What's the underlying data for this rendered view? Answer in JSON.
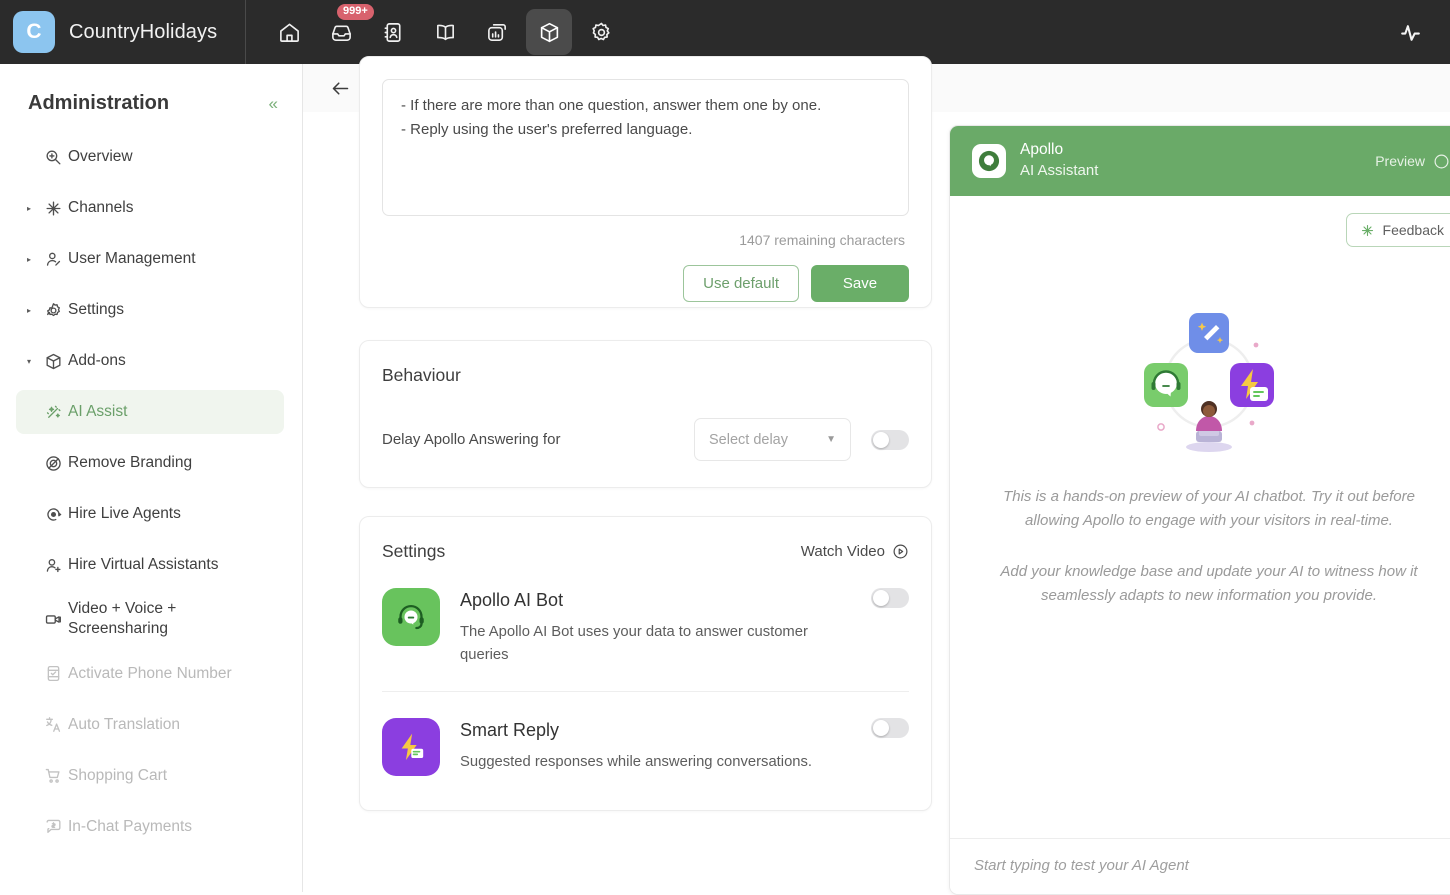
{
  "topbar": {
    "brand_initial": "C",
    "brand_name": "CountryHolidays",
    "nav": [
      {
        "name": "home-icon",
        "label": "Home",
        "active": false,
        "badge": ""
      },
      {
        "name": "inbox-icon",
        "label": "Inbox",
        "active": false,
        "badge": "999+"
      },
      {
        "name": "contacts-icon",
        "label": "Contacts",
        "active": false,
        "badge": ""
      },
      {
        "name": "knowledge-book-icon",
        "label": "Knowledge Base",
        "active": false,
        "badge": ""
      },
      {
        "name": "reports-icon",
        "label": "Reports",
        "active": false,
        "badge": ""
      },
      {
        "name": "addons-package-icon",
        "label": "Add-ons",
        "active": true,
        "badge": ""
      },
      {
        "name": "settings-gear-icon",
        "label": "Settings",
        "active": false,
        "badge": ""
      }
    ],
    "status_icon": "activity-pulse-icon"
  },
  "sidebar": {
    "title": "Administration",
    "collapse_glyph": "«",
    "items": [
      {
        "label": "Overview",
        "icon": "overview-icon",
        "caret": false,
        "selected": false,
        "disabled": false,
        "sub": false
      },
      {
        "label": "Channels",
        "icon": "channels-icon",
        "caret": true,
        "selected": false,
        "disabled": false,
        "sub": false
      },
      {
        "label": "User Management",
        "icon": "user-management-icon",
        "caret": true,
        "selected": false,
        "disabled": false,
        "sub": false
      },
      {
        "label": "Settings",
        "icon": "settings-icon",
        "caret": true,
        "selected": false,
        "disabled": false,
        "sub": false
      },
      {
        "label": "Add-ons",
        "icon": "addons-icon",
        "caret": "down",
        "selected": false,
        "disabled": false,
        "sub": false
      },
      {
        "label": "AI Assist",
        "icon": "ai-assist-icon",
        "caret": false,
        "selected": true,
        "disabled": false,
        "sub": true
      },
      {
        "label": "Remove Branding",
        "icon": "remove-branding-icon",
        "caret": false,
        "selected": false,
        "disabled": false,
        "sub": true
      },
      {
        "label": "Hire Live Agents",
        "icon": "hire-live-agents-icon",
        "caret": false,
        "selected": false,
        "disabled": false,
        "sub": true
      },
      {
        "label": "Hire Virtual Assistants",
        "icon": "hire-va-icon",
        "caret": false,
        "selected": false,
        "disabled": false,
        "sub": true
      },
      {
        "label": "Video + Voice + Screensharing",
        "icon": "video-voice-icon",
        "caret": false,
        "selected": false,
        "disabled": false,
        "sub": true
      },
      {
        "label": "Activate Phone Number",
        "icon": "phone-number-icon",
        "caret": false,
        "selected": false,
        "disabled": true,
        "sub": true
      },
      {
        "label": "Auto Translation",
        "icon": "auto-translation-icon",
        "caret": false,
        "selected": false,
        "disabled": true,
        "sub": true
      },
      {
        "label": "Shopping Cart",
        "icon": "shopping-cart-icon",
        "caret": false,
        "selected": false,
        "disabled": true,
        "sub": true
      },
      {
        "label": "In-Chat Payments",
        "icon": "in-chat-payments-icon",
        "caret": false,
        "selected": false,
        "disabled": true,
        "sub": true
      }
    ]
  },
  "main": {
    "back_label": "Back",
    "prompt": {
      "line1": "- If there are more than one question, answer them one by one.",
      "line2": "- Reply using the user's preferred language.",
      "char_count": "1407 remaining characters",
      "use_default_label": "Use default",
      "save_label": "Save"
    },
    "behaviour": {
      "title": "Behaviour",
      "delay_label": "Delay Apollo Answering for",
      "select_value": "Select delay",
      "toggle_on": false
    },
    "settings": {
      "title": "Settings",
      "watch_video_label": "Watch Video",
      "features": [
        {
          "title": "Apollo AI Bot",
          "desc": "The Apollo AI Bot uses your data to answer customer queries",
          "icon": "apollo-bot-icon",
          "icon_color": "#68c35d",
          "toggle_on": false
        },
        {
          "title": "Smart Reply",
          "desc": "Suggested responses while answering conversations.",
          "icon": "smart-reply-icon",
          "icon_color": "#8b3ee0",
          "toggle_on": false
        }
      ]
    }
  },
  "preview": {
    "bot_name": "Apollo",
    "bot_subtitle": "AI Assistant",
    "preview_label": "Preview",
    "feedback_label": "Feedback",
    "body_paragraph_1": "This is a hands-on preview of your AI chatbot. Try it out before allowing Apollo to engage with your visitors in real-time.",
    "body_paragraph_2": "Add your knowledge base and update your AI to witness how it seamlessly adapts to new information you provide.",
    "composer_placeholder": "Start typing to test your AI Agent"
  },
  "colors": {
    "accent_green": "#6aae68",
    "header_dark": "#2b2b2b",
    "brand_blue": "#8cc5ef",
    "badge_red": "#d8626d",
    "selected_bg": "#f0f5ee"
  }
}
